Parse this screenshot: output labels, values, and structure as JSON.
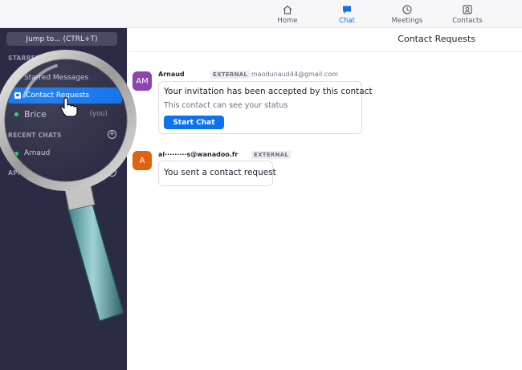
{
  "topnav": {
    "items": [
      {
        "label": "Home",
        "icon": "home-icon",
        "active": false
      },
      {
        "label": "Chat",
        "icon": "chat-icon",
        "active": true
      },
      {
        "label": "Meetings",
        "icon": "clock-icon",
        "active": false
      },
      {
        "label": "Contacts",
        "icon": "contacts-icon",
        "active": false
      }
    ]
  },
  "sidebar": {
    "jump_label": "Jump to... (CTRL+T)",
    "starred_section": "STARRED",
    "starred_messages": "Starred Messages",
    "contact_requests": "Contact Requests",
    "self_name": "Brice",
    "self_suffix": "(you)",
    "recent_section": "RECENT CHATS",
    "recent_items": [
      {
        "name": "Arnaud"
      }
    ],
    "apps_section": "APPS"
  },
  "main": {
    "title": "Contact Requests",
    "messages": [
      {
        "avatar_initials": "AM",
        "avatar_color": "#8e44ad",
        "sender": "Arnaud",
        "badge": "EXTERNAL",
        "email": "maodunaud44@gmail.com",
        "text": "Your invitation has been accepted by this contact",
        "subtext": "This contact can see your status",
        "button": "Start Chat"
      },
      {
        "avatar_initials": "A",
        "avatar_color": "#e0610f",
        "sender": "al·········s@wanadoo.fr",
        "badge": "EXTERNAL",
        "text": "You sent a contact request"
      }
    ]
  },
  "colors": {
    "accent": "#0e72ed",
    "sidebar_bg": "#2b2b45",
    "online": "#2fcc71"
  }
}
